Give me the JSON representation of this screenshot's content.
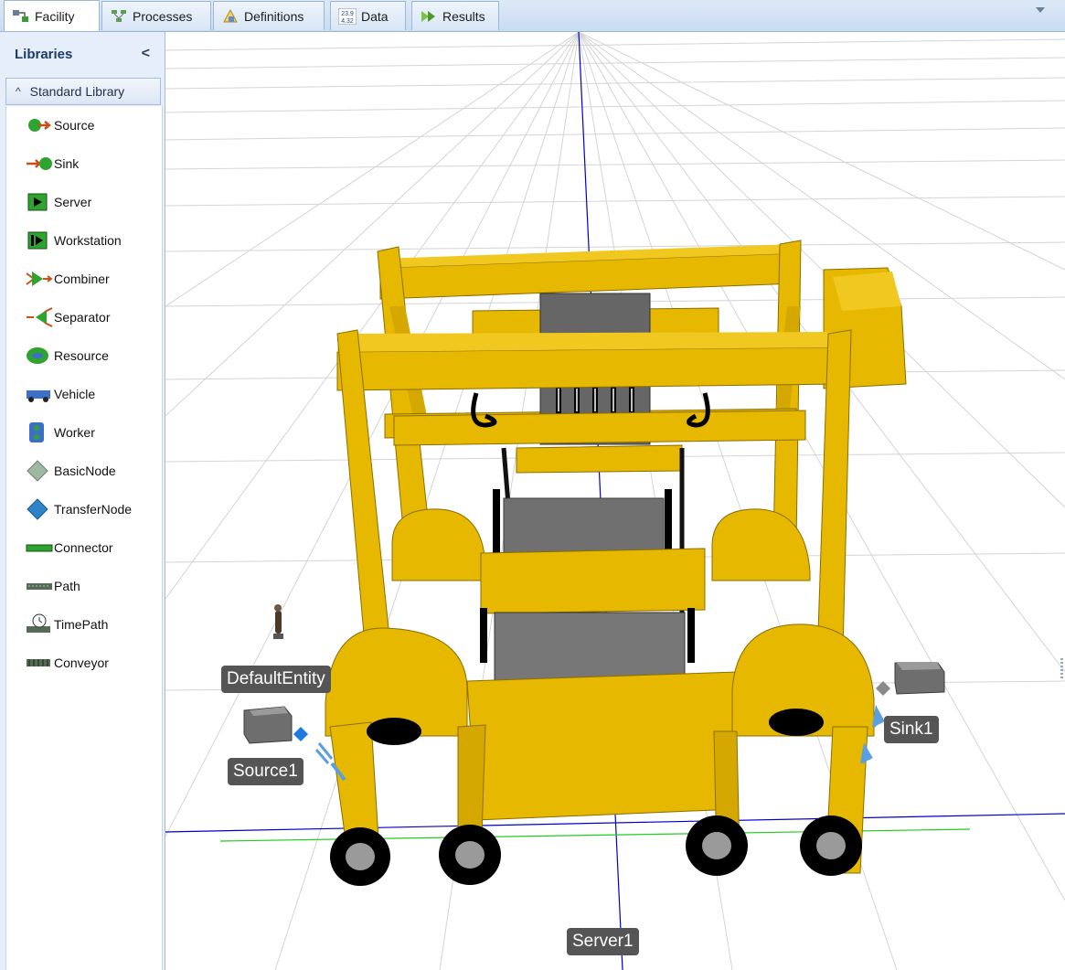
{
  "tabs": [
    {
      "label": "Facility",
      "icon": "facility-icon",
      "active": true
    },
    {
      "label": "Processes",
      "icon": "processes-icon",
      "active": false
    },
    {
      "label": "Definitions",
      "icon": "definitions-icon",
      "active": false
    },
    {
      "label": "Data",
      "icon": "data-icon",
      "active": false
    },
    {
      "label": "Results",
      "icon": "results-icon",
      "active": false
    }
  ],
  "sidebar": {
    "title": "Libraries",
    "collapse_glyph": "<",
    "section_label": "Standard Library",
    "items": [
      {
        "label": "Source",
        "icon": "source-icon"
      },
      {
        "label": "Sink",
        "icon": "sink-icon"
      },
      {
        "label": "Server",
        "icon": "server-icon"
      },
      {
        "label": "Workstation",
        "icon": "workstation-icon"
      },
      {
        "label": "Combiner",
        "icon": "combiner-icon"
      },
      {
        "label": "Separator",
        "icon": "separator-icon"
      },
      {
        "label": "Resource",
        "icon": "resource-icon"
      },
      {
        "label": "Vehicle",
        "icon": "vehicle-icon"
      },
      {
        "label": "Worker",
        "icon": "worker-icon"
      },
      {
        "label": "BasicNode",
        "icon": "basic-node-icon"
      },
      {
        "label": "TransferNode",
        "icon": "transfer-node-icon"
      },
      {
        "label": "Connector",
        "icon": "connector-icon"
      },
      {
        "label": "Path",
        "icon": "path-icon"
      },
      {
        "label": "TimePath",
        "icon": "time-path-icon"
      },
      {
        "label": "Conveyor",
        "icon": "conveyor-icon"
      }
    ]
  },
  "viewport": {
    "labels": {
      "default_entity": "DefaultEntity",
      "source": "Source1",
      "sink": "Sink1",
      "server": "Server1"
    },
    "colors": {
      "gantry_yellow": "#e6b800",
      "gantry_shadow": "#b88f00",
      "container_gray": "#707070",
      "axis_blue": "#0000cc",
      "axis_green": "#22cc22"
    }
  },
  "data_icon_text": {
    "top": "23.9",
    "bottom": "4.32"
  }
}
